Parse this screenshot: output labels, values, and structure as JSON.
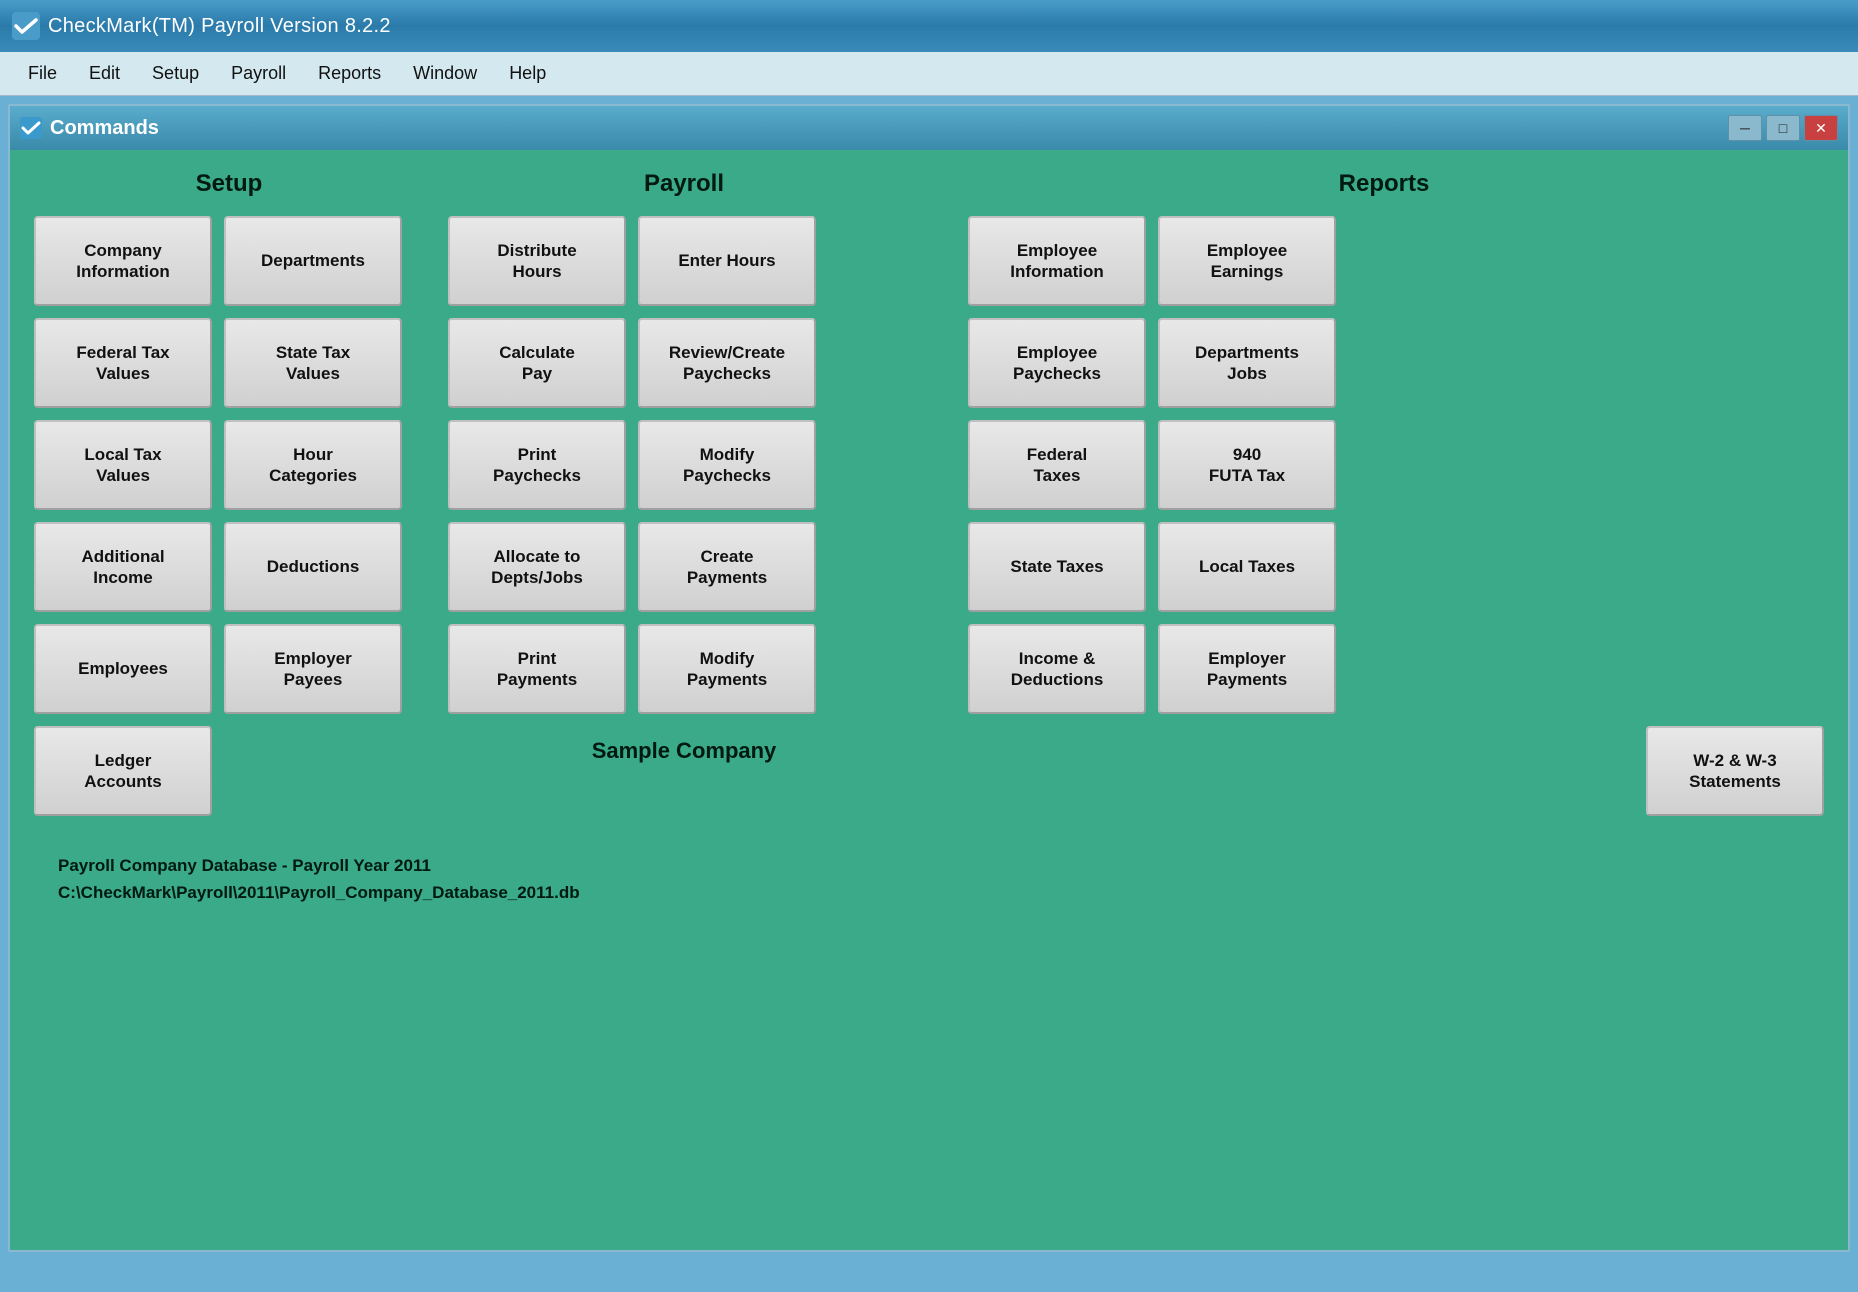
{
  "titleBar": {
    "title": "CheckMark(TM) Payroll Version 8.2.2"
  },
  "menuBar": {
    "items": [
      "File",
      "Edit",
      "Setup",
      "Payroll",
      "Reports",
      "Window",
      "Help"
    ]
  },
  "window": {
    "title": "Commands",
    "controls": [
      "─",
      "□",
      "✕"
    ]
  },
  "sections": {
    "setup": {
      "header": "Setup",
      "buttons": [
        [
          "Company\nInformation",
          "Departments"
        ],
        [
          "Federal Tax\nValues",
          "State Tax\nValues"
        ],
        [
          "Local Tax\nValues",
          "Hour\nCategories"
        ],
        [
          "Additional\nIncome",
          "Deductions"
        ],
        [
          "Employees",
          "Employer\nPayees"
        ],
        [
          "Ledger\nAccounts",
          null
        ]
      ]
    },
    "payroll": {
      "header": "Payroll",
      "buttons": [
        [
          "Distribute\nHours",
          "Enter Hours"
        ],
        [
          "Calculate\nPay",
          "Review/Create\nPaychecks"
        ],
        [
          "Print\nPaychecks",
          "Modify\nPaychecks"
        ],
        [
          "Allocate to\nDepts/Jobs",
          "Create\nPayments"
        ],
        [
          "Print\nPayments",
          "Modify\nPayments"
        ]
      ]
    },
    "reports": {
      "header": "Reports",
      "buttons": [
        [
          "Employee\nInformation",
          "Employee\nEarnings"
        ],
        [
          "Employee\nPaychecks",
          "Departments\nJobs"
        ],
        [
          "Federal\nTaxes",
          "940\nFUTA Tax"
        ],
        [
          "State Taxes",
          "Local Taxes"
        ],
        [
          "Income &\nDeductions",
          "Employer\nPayments"
        ],
        [
          "W-2 & W-3\nStatements",
          null
        ]
      ]
    }
  },
  "sampleCompany": "Sample Company",
  "statusBar": {
    "line1": "Payroll Company Database - Payroll Year 2011",
    "line2": "C:\\CheckMark\\Payroll\\2011\\Payroll_Company_Database_2011.db"
  }
}
